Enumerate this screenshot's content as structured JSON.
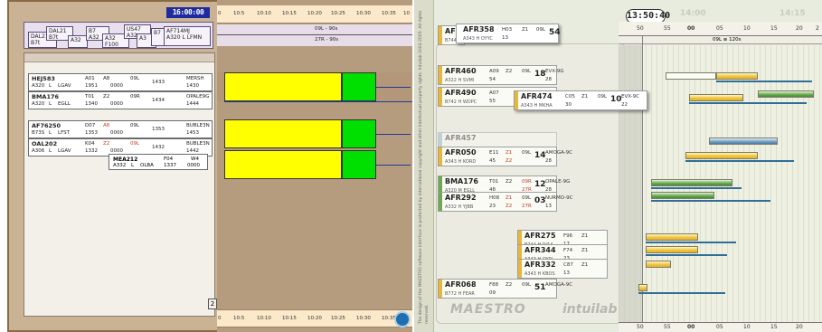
{
  "left_screen": {
    "clock": "16:00:00",
    "stack_labels": [
      {
        "cs": "DAL21",
        "l1": "B7t",
        "l2": "A320"
      },
      {
        "cs": "A3",
        "l1": "B7",
        "l2": "A32"
      },
      {
        "cs": "B7",
        "l1": "A32",
        "l2": "F100"
      },
      {
        "cs": "US47",
        "l1": "A32",
        "l2": "A3"
      },
      {
        "cs": "AF714MJ",
        "l1": "A320 L LFMN",
        "l2": "B7"
      }
    ],
    "strips": [
      {
        "cs": "HEJ583",
        "type": "A320",
        "cat": "L",
        "dest": "LGAV",
        "stand": "A01",
        "stand2": "1951",
        "gate": "A8",
        "rw": "09L",
        "slot": "0000",
        "ttot": "1433",
        "sid": "MERSH",
        "sid2": "1430"
      },
      {
        "cs": "BMA176",
        "type": "A320",
        "cat": "L",
        "dest": "EGLL",
        "stand": "T01",
        "stand2": "1340",
        "gate": "Z2",
        "rw": "09R",
        "slot": "0000",
        "ttot": "1434",
        "sid": "OPALE9G",
        "sid2": "1444"
      },
      {
        "cs": "AF76250",
        "type": "B73S",
        "cat": "L",
        "dest": "LFST",
        "stand": "D07",
        "stand2": "1353",
        "gate": "A8",
        "rw": "09L",
        "slot": "0000",
        "ttot": "1353",
        "sid": "BUBLE3N",
        "sid2": "1453"
      },
      {
        "cs": "OAL202",
        "type": "A306",
        "cat": "L",
        "dest": "LGAV",
        "stand": "K04",
        "stand2": "1332",
        "gate": "Z2",
        "rw": "09L",
        "slot": "0000",
        "ttot": "1432",
        "sid": "BUBLE3N",
        "sid2": "1442"
      }
    ],
    "mea": {
      "cs": "MEA212",
      "type": "A332",
      "cat": "L",
      "dest": "OLBA",
      "stand": "F04",
      "stand2": "1337",
      "gate": "W4",
      "slot": "0000"
    },
    "counter": "2",
    "ruler_ticks": [
      "0",
      "10:5",
      "10:10",
      "10:15",
      "10:20",
      "10:25",
      "10:30",
      "10:35",
      "10"
    ],
    "runway_labels": [
      "09L - 90s",
      "27R - 90s"
    ]
  },
  "right_screen": {
    "clock": "13:50:40",
    "faint_ticks": [
      "14:00",
      "14:15"
    ],
    "ruler_ticks": [
      "50",
      "55",
      "00",
      "05",
      "10",
      "15",
      "20",
      "2"
    ],
    "runway_strip": "09L ≡ 120s",
    "copyright": "The design of the MAESTRO software interface is protected by international copyright and other intellectual property rights. Intuilab 2004-2005. All rights reserved.",
    "logo_left": "MAESTRO",
    "logo_right": "intuilab",
    "strips": [
      {
        "cs": "AFR5",
        "type": "B744",
        "stand": "",
        "gate": "",
        "rw": "",
        "num": "",
        "faded": false
      },
      {
        "cs": "AFR358",
        "type": "A343 H OYYC",
        "stand": "H03",
        "time": "13",
        "gate": "Z1",
        "rw": "09L",
        "slotnum": "54",
        "faded": false
      },
      {
        "cs": "AFR460",
        "type": "A322 H SVMI",
        "stand": "A09",
        "time": "54",
        "gate": "Z2",
        "rw": "09L",
        "slotnum": "18",
        "sid": "EVX-9G",
        "sidt": "28",
        "faded": false
      },
      {
        "cs": "AFR490",
        "type": "B742 H WDPC",
        "stand": "A07",
        "time": "55",
        "gate": "Z1",
        "rw": "09L",
        "slotnum": "",
        "sid": "EVX-9C",
        "sidt": "",
        "faded": false
      },
      {
        "cs": "AFR474",
        "type": "A343 H MKHA",
        "stand": "C05",
        "time": "30",
        "gate": "Z1",
        "rw": "09L",
        "slotnum": "10",
        "sid": "EVX-9C",
        "sidt": "22",
        "faded": false
      },
      {
        "cs": "AFR457",
        "type": "",
        "stand": "",
        "time": "",
        "gate": "",
        "rw": "",
        "slotnum": "",
        "sid": "",
        "sidt": "",
        "faded": true
      },
      {
        "cs": "AFR050",
        "type": "A343 H KORD",
        "stand": "E11",
        "time": "45",
        "gate": "Z1",
        "gate2": "Z2",
        "rw": "09L",
        "slotnum": "14",
        "sid": "AMOGA-9C",
        "sidt": "28",
        "faded": false
      },
      {
        "cs": "BMA176",
        "type": "A320 M EGLL",
        "stand": "T01",
        "time": "48",
        "gate": "Z2",
        "rw": "09R",
        "rw2": "27R",
        "slotnum": "12",
        "sid": "OPALE-9G",
        "sidt": "28",
        "faded": false
      },
      {
        "cs": "AFR292",
        "type": "A332 H YJBB",
        "stand": "H08",
        "time": "23",
        "gate": "Z1",
        "gate2": "Z2",
        "rw": "09L",
        "rw2": "27R",
        "slotnum": "03",
        "sid": "NURMO-9C",
        "sidt": "13",
        "faded": false
      },
      {
        "cs": "AFR275",
        "type": "B744 H RJAA",
        "stand": "F96",
        "time": "17",
        "gate": "Z1",
        "faded": false
      },
      {
        "cs": "AFR344",
        "type": "A343 H OYRL",
        "stand": "F74",
        "time": "23",
        "gate": "Z1",
        "faded": false
      },
      {
        "cs": "AFR332",
        "type": "A343 H KBOS",
        "stand": "C87",
        "time": "13",
        "gate": "Z1",
        "faded": false
      },
      {
        "cs": "AFR068",
        "type": "B772 H FEAR",
        "stand": "F88",
        "time": "09",
        "gate": "Z2",
        "rw": "09L",
        "slotnum": "51",
        "sid": "AMOGA-9C",
        "sidt": "",
        "faded": false
      }
    ]
  }
}
